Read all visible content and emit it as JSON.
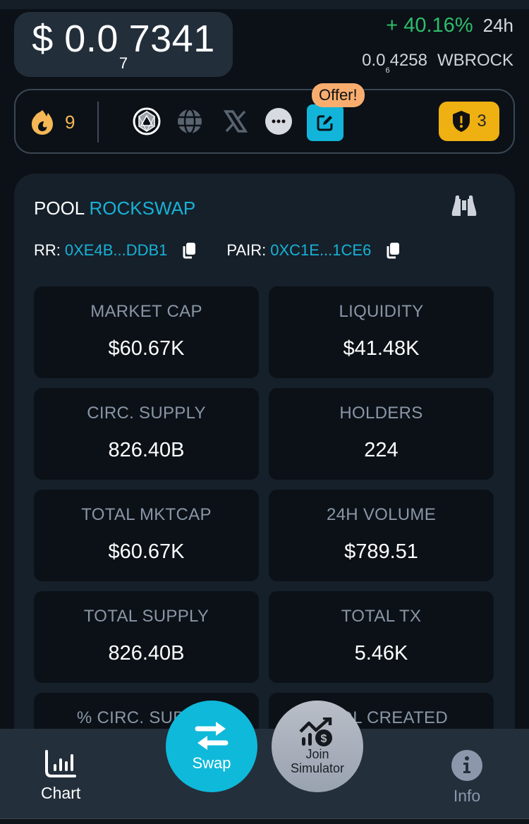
{
  "header": {
    "price_prefix": "$ 0.0",
    "price_zeros": "7",
    "price_digits": "7341",
    "change_pct": "+ 40.16%",
    "change_period": "24h",
    "pair_price_prefix": "0.0",
    "pair_price_zeros": "6",
    "pair_price_digits": "4258",
    "pair_symbol": "WBROCK"
  },
  "social": {
    "fire_count": "9",
    "icons": [
      "chain-logo-icon",
      "globe-icon",
      "x-twitter-icon",
      "more-icon",
      "edit-icon"
    ],
    "offer_label": "Offer!",
    "warning_count": "3"
  },
  "pool": {
    "label": "POOL",
    "name": "ROCKSWAP",
    "rr_label": "RR:",
    "rr_value": "0XE4B...DDB1",
    "pair_label": "PAIR:",
    "pair_value": "0XC1E...1CE6"
  },
  "stats": [
    {
      "label": "MARKET CAP",
      "value": "$60.67K"
    },
    {
      "label": "LIQUIDITY",
      "value": "$41.48K"
    },
    {
      "label": "CIRC. SUPPLY",
      "value": "826.40B"
    },
    {
      "label": "HOLDERS",
      "value": "224"
    },
    {
      "label": "TOTAL MKTCAP",
      "value": "$60.67K"
    },
    {
      "label": "24H VOLUME",
      "value": "$789.51"
    },
    {
      "label": "TOTAL SUPPLY",
      "value": "826.40B"
    },
    {
      "label": "TOTAL TX",
      "value": "5.46K"
    },
    {
      "label": "% CIRC. SUPPLY",
      "value": ""
    },
    {
      "label": "POOL CREATED",
      "value": ""
    }
  ],
  "nav": {
    "chart": "Chart",
    "swap": "Swap",
    "simulator_line1": "Join",
    "simulator_line2": "Simulator",
    "info": "Info"
  },
  "colors": {
    "accent": "#12b5d9",
    "positive": "#2ebd6b",
    "warning": "#efb012",
    "offer": "#f8ad6f",
    "fire": "#f6b756"
  }
}
